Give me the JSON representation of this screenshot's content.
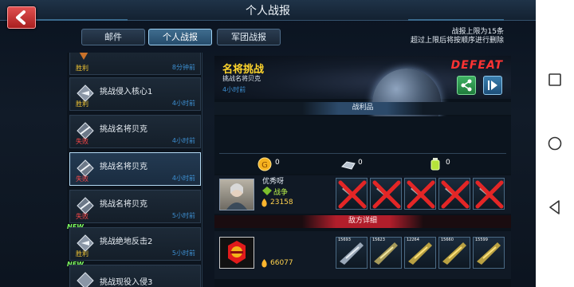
{
  "header": {
    "title": "个人战报",
    "back_label": "back"
  },
  "tabs": [
    {
      "label": "邮件",
      "active": false
    },
    {
      "label": "个人战报",
      "active": true
    },
    {
      "label": "军团战报",
      "active": false
    }
  ],
  "limit_note": {
    "line1": "战报上限为15条",
    "line2": "超过上限后将按顺序进行删除"
  },
  "reports": [
    {
      "title": "",
      "result": "胜利",
      "result_type": "win",
      "time": "8分钟前",
      "new": false,
      "selected": false
    },
    {
      "title": "挑战侵入核心1",
      "result": "胜利",
      "result_type": "win",
      "time": "4小时前",
      "new": false,
      "selected": false
    },
    {
      "title": "挑战名将贝克",
      "result": "失败",
      "result_type": "lose",
      "time": "4小时前",
      "new": false,
      "selected": false
    },
    {
      "title": "挑战名将贝克",
      "result": "失败",
      "result_type": "lose",
      "time": "4小时前",
      "new": false,
      "selected": true
    },
    {
      "title": "挑战名将贝克",
      "result": "失败",
      "result_type": "lose",
      "time": "5小时前",
      "new": false,
      "selected": false
    },
    {
      "title": "挑战绝地反击2",
      "result": "胜利",
      "result_type": "win",
      "time": "5小时前",
      "new": true,
      "selected": false
    },
    {
      "title": "挑战现役入侵3",
      "result": "",
      "result_type": "win",
      "time": "",
      "new": true,
      "selected": false
    }
  ],
  "new_badge": "NEW",
  "detail": {
    "title": "名将挑战",
    "subtitle": "挑战名将贝克",
    "time": "4小时前",
    "outcome": "DEFEAT",
    "share_icon": "share-icon",
    "replay_icon": "play-icon"
  },
  "loot": {
    "heading": "战利品",
    "items": [
      {
        "icon": "gold-coin-icon",
        "value": "0"
      },
      {
        "icon": "metal-ore-icon",
        "value": "0"
      },
      {
        "icon": "energy-crystal-icon",
        "value": "0"
      }
    ]
  },
  "player": {
    "name": "优秀呀",
    "status": "战争",
    "power": "23158"
  },
  "enemy": {
    "heading": "敌方详细",
    "power": "66077",
    "ship_levels": [
      "15693",
      "15623",
      "12264",
      "15660",
      "15599"
    ]
  },
  "colors": {
    "win": "#f0c433",
    "lose": "#ff4848",
    "defeat": "#ff3333",
    "highlight": "#ffd52c"
  }
}
